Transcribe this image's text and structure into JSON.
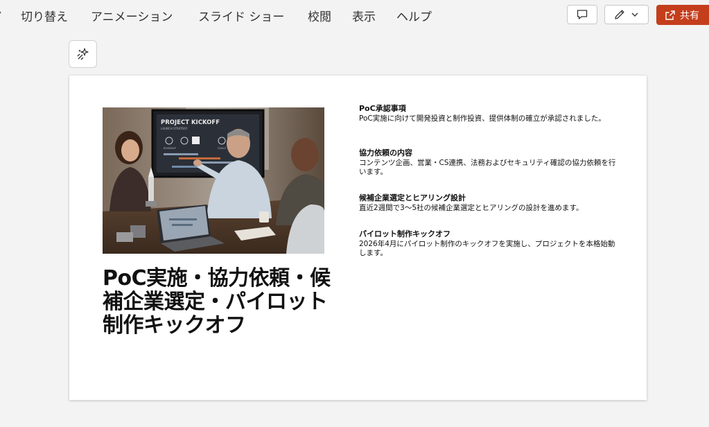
{
  "menu": {
    "items": [
      {
        "label": "切り替え",
        "name": "menu-transitions"
      },
      {
        "label": "アニメーション",
        "name": "menu-animations"
      },
      {
        "label": "スライド ショー",
        "name": "menu-slideshow"
      },
      {
        "label": "校閲",
        "name": "menu-review"
      },
      {
        "label": "表示",
        "name": "menu-view"
      },
      {
        "label": "ヘルプ",
        "name": "menu-help"
      }
    ],
    "share_label": "共有"
  },
  "photo": {
    "screen_title": "PROJECT KICKOFF",
    "screen_subtitle": "LAUNCH STRATEGY",
    "screen_label_1": "ROADMAP",
    "screen_label_2": "GOALS"
  },
  "slide": {
    "title": "PoC実施・協力依頼・候補企業選定・パイロット制作キックオフ",
    "sections": [
      {
        "heading": "PoC承認事項",
        "body": "PoC実施に向けて開発投資と制作投資、提供体制の確立が承認されました。"
      },
      {
        "heading": "協力依頼の内容",
        "body": "コンテンツ企画、営業・CS連携、法務およびセキュリティ確認の協力依頼を行います。"
      },
      {
        "heading": "候補企業選定とヒアリング設計",
        "body": "直近2週間で3～5社の候補企業選定とヒアリングの設計を進めます。"
      },
      {
        "heading": "パイロット制作キックオフ",
        "body": "2026年4月にパイロット制作のキックオフを実施し、プロジェクトを本格始動します。"
      }
    ]
  },
  "colors": {
    "share_bg": "#c43e1c",
    "app_bg": "#f3f3f3"
  }
}
